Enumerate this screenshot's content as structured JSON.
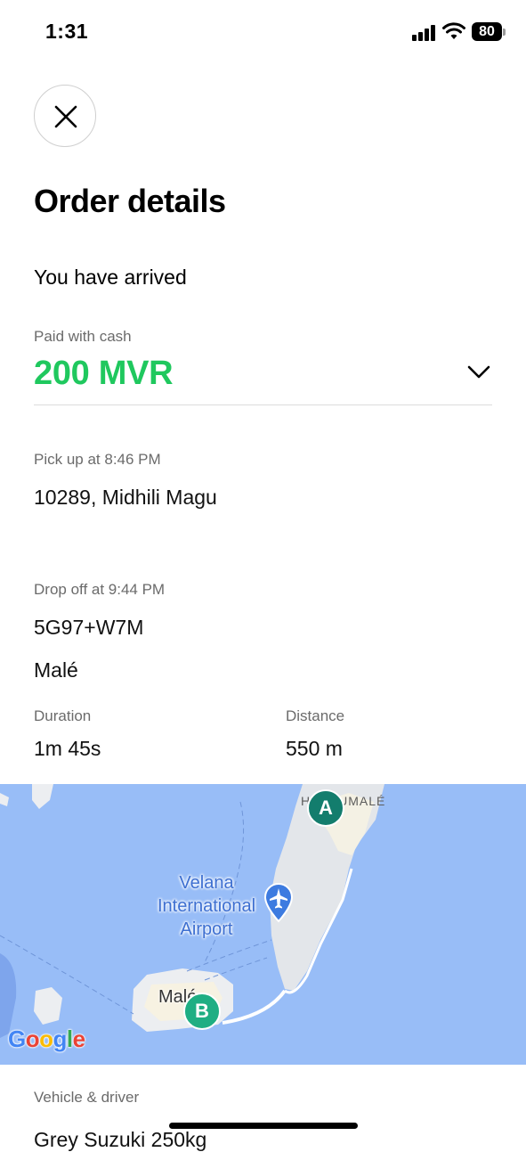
{
  "status_bar": {
    "time": "1:31",
    "battery": "80"
  },
  "header": {
    "title": "Order details"
  },
  "trip_status": "You have arrived",
  "payment": {
    "label": "Paid with cash",
    "amount": "200 MVR"
  },
  "pickup": {
    "label": "Pick up at 8:46 PM",
    "address": "10289, Midhili Magu"
  },
  "dropoff": {
    "label": "Drop off at 9:44 PM",
    "address_line1": "5G97+W7M",
    "address_line2": "Malé"
  },
  "stats": {
    "duration_label": "Duration",
    "duration_value": "1m 45s",
    "distance_label": "Distance",
    "distance_value": "550 m"
  },
  "map": {
    "airport_label_line1": "Velana",
    "airport_label_line2": "International",
    "airport_label_line3": "Airport",
    "hulhumale_label": "HULHUMALÉ",
    "male_label": "Malé",
    "marker_a": "A",
    "marker_b": "B",
    "attribution": "Google"
  },
  "vehicle": {
    "label": "Vehicle & driver",
    "value": "Grey Suzuki 250kg"
  },
  "icons": [
    "close-icon",
    "chevron-down-icon",
    "signal-icon",
    "wifi-icon",
    "battery-icon",
    "airport-pin-icon"
  ],
  "colors": {
    "accent": "#1fc85e",
    "map_water": "#98bdf7",
    "marker_a": "#137d6d",
    "marker_b": "#1fae83"
  }
}
